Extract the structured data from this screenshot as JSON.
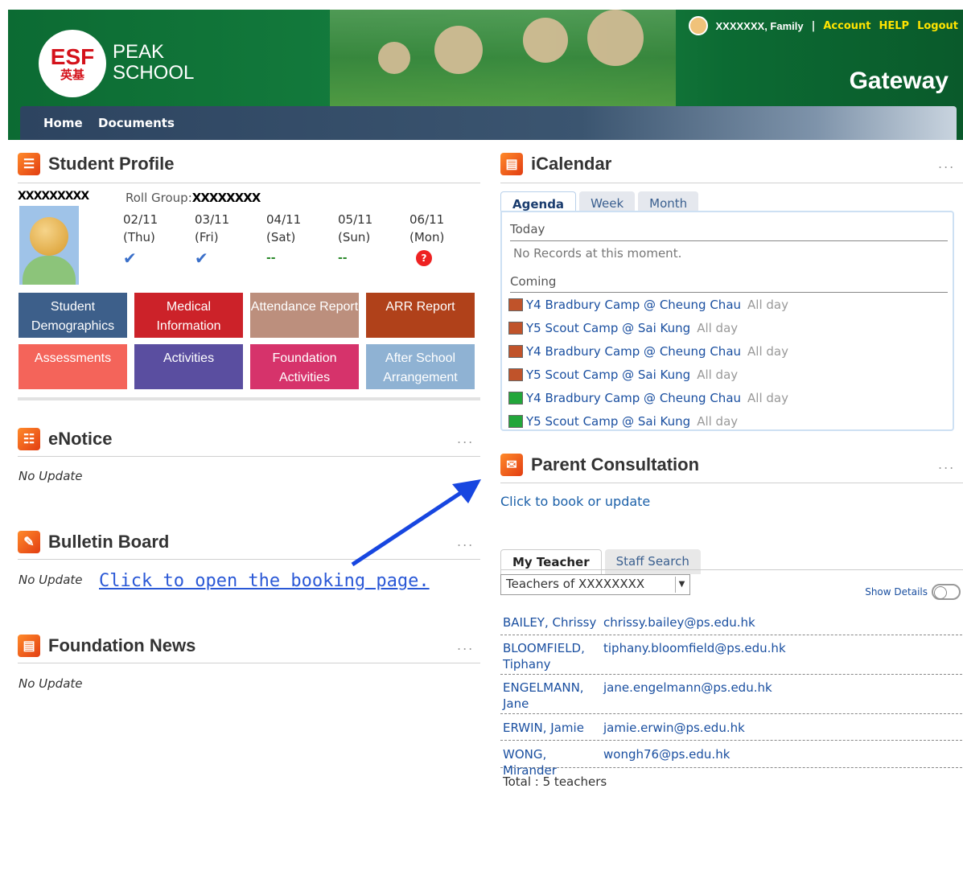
{
  "header": {
    "logo_text": "ESF",
    "logo_cn": "英基",
    "school_line1": "PEAK",
    "school_line2": "SCHOOL",
    "user_name": "XXXXXXX, Family",
    "separator": "|",
    "account": "Account",
    "help": "HELP",
    "logout": "Logout",
    "portal_title": "Gateway"
  },
  "nav": {
    "home": "Home",
    "documents": "Documents"
  },
  "student_profile": {
    "title": "Student Profile",
    "student_name": "XXXXXXXXX",
    "roll_group_label": "Roll Group:",
    "roll_group_value": "XXXXXXXX",
    "days": [
      {
        "date": "02/11",
        "dow": "(Thu)",
        "mark": "present"
      },
      {
        "date": "03/11",
        "dow": "(Fri)",
        "mark": "present"
      },
      {
        "date": "04/11",
        "dow": "(Sat)",
        "mark": "--"
      },
      {
        "date": "05/11",
        "dow": "(Sun)",
        "mark": "--"
      },
      {
        "date": "06/11",
        "dow": "(Mon)",
        "mark": "absent"
      }
    ],
    "tiles": [
      {
        "label": "Student Demographics",
        "color": "#3d5f8a"
      },
      {
        "label": "Medical Information",
        "color": "#cc2229"
      },
      {
        "label": "Attendance Report",
        "color": "#bc8f7d"
      },
      {
        "label": "ARR Report",
        "color": "#b0411a"
      },
      {
        "label": "Assessments",
        "color": "#f4645a"
      },
      {
        "label": "Activities",
        "color": "#5a4ea0"
      },
      {
        "label": "Foundation Activities",
        "color": "#d6336b"
      },
      {
        "label": "After School Arrangement",
        "color": "#8fb2d3"
      }
    ]
  },
  "enotice": {
    "title": "eNotice",
    "content": "No Update",
    "more": "..."
  },
  "bulletin": {
    "title": "Bulletin Board",
    "content": "No Update",
    "more": "..."
  },
  "foundation_news": {
    "title": "Foundation News",
    "content": "No Update",
    "more": "..."
  },
  "annotation": {
    "link_text": "Click to open the booking page."
  },
  "icalendar": {
    "title": "iCalendar",
    "more": "...",
    "tabs": [
      "Agenda",
      "Week",
      "Month"
    ],
    "today_label": "Today",
    "no_records": "No Records at this moment.",
    "coming_label": "Coming",
    "events": [
      {
        "title": "Y4 Bradbury Camp @ Cheung Chau",
        "when": "All day",
        "color": "#c0532a"
      },
      {
        "title": "Y5 Scout Camp @ Sai Kung",
        "when": "All day",
        "color": "#c0532a"
      },
      {
        "title": "Y4 Bradbury Camp @ Cheung Chau",
        "when": "All day",
        "color": "#c0532a"
      },
      {
        "title": "Y5 Scout Camp @ Sai Kung",
        "when": "All day",
        "color": "#c0532a"
      },
      {
        "title": "Y4 Bradbury Camp @ Cheung Chau",
        "when": "All day",
        "color": "#22a63a"
      },
      {
        "title": "Y5 Scout Camp @ Sai Kung",
        "when": "All day",
        "color": "#22a63a"
      }
    ]
  },
  "parent_consultation": {
    "title": "Parent Consultation",
    "more": "...",
    "book_link": "Click to book or update"
  },
  "teachers": {
    "tabs": [
      "My Teacher",
      "Staff Search"
    ],
    "select_value": "Teachers of XXXXXXXX",
    "show_details": "Show Details",
    "rows": [
      {
        "name": "BAILEY, Chrissy",
        "email": "chrissy.bailey@ps.edu.hk"
      },
      {
        "name": "BLOOMFIELD, Tiphany",
        "email": "tiphany.bloomfield@ps.edu.hk"
      },
      {
        "name": "ENGELMANN, Jane",
        "email": "jane.engelmann@ps.edu.hk"
      },
      {
        "name": "ERWIN, Jamie",
        "email": "jamie.erwin@ps.edu.hk"
      },
      {
        "name": "WONG, Mirander",
        "email": "wongh76@ps.edu.hk"
      }
    ],
    "total": "Total : 5 teachers"
  }
}
